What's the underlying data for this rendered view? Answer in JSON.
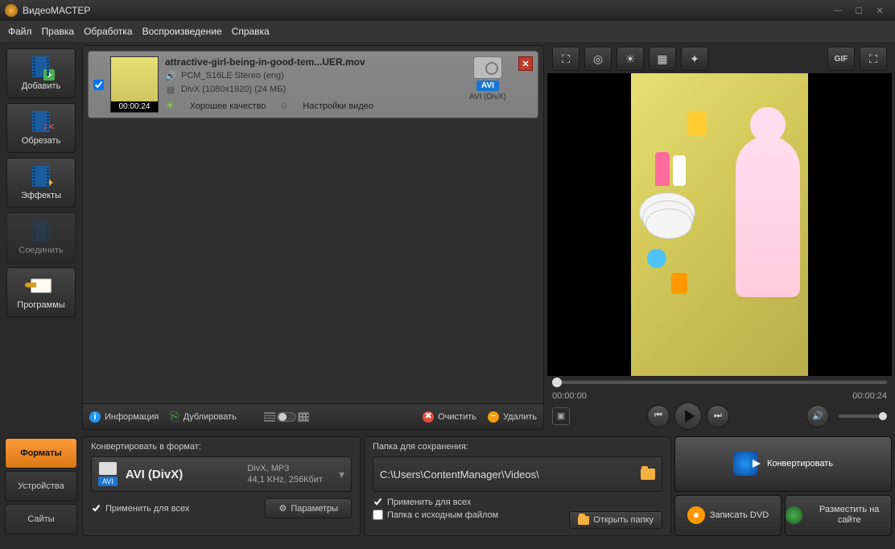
{
  "app": {
    "title": "ВидеоМАСТЕР"
  },
  "menu": [
    "Файл",
    "Правка",
    "Обработка",
    "Воспроизведение",
    "Справка"
  ],
  "toolbar": {
    "add": "Добавить",
    "cut": "Обрезать",
    "effects": "Эффекты",
    "join": "Соединить",
    "programs": "Программы"
  },
  "file": {
    "name": "attractive-girl-being-in-good-tem...UER.mov",
    "audio": "PCM_S16LE Stereo (eng)",
    "video": "DivX (1080x1920) (24 МБ)",
    "quality": "Хорошее качество",
    "settings": "Настройки видео",
    "duration": "00:00:24",
    "out_badge": "AVI",
    "out_desc": "AVI (DivX)"
  },
  "listbar": {
    "info": "Информация",
    "duplicate": "Дублировать",
    "clear": "Очистить",
    "delete": "Удалить"
  },
  "preview": {
    "btns": {
      "crop": "crop",
      "rotate": "rotate",
      "brightness": "brightness",
      "effects": "fx",
      "speed": "speed",
      "gif": "GIF",
      "fullscreen": "fullscreen"
    },
    "time_start": "00:00:00",
    "time_end": "00:00:24"
  },
  "tabs": {
    "formats": "Форматы",
    "devices": "Устройства",
    "sites": "Сайты"
  },
  "formatPanel": {
    "title": "Конвертировать в формат:",
    "badge": "AVI",
    "name": "AVI (DivX)",
    "line1": "DivX, MP3",
    "line2": "44,1 KHz, 256Кбит",
    "applyAll": "Применить для всех",
    "params": "Параметры"
  },
  "folderPanel": {
    "title": "Папка для сохранения:",
    "path": "C:\\Users\\ContentManager\\Videos\\",
    "applyAll": "Применить для всех",
    "sourceFolder": "Папка с исходным файлом",
    "open": "Открыть папку"
  },
  "actions": {
    "convert": "Конвертировать",
    "dvd": "Записать DVD",
    "publish": "Разместить на сайте"
  }
}
